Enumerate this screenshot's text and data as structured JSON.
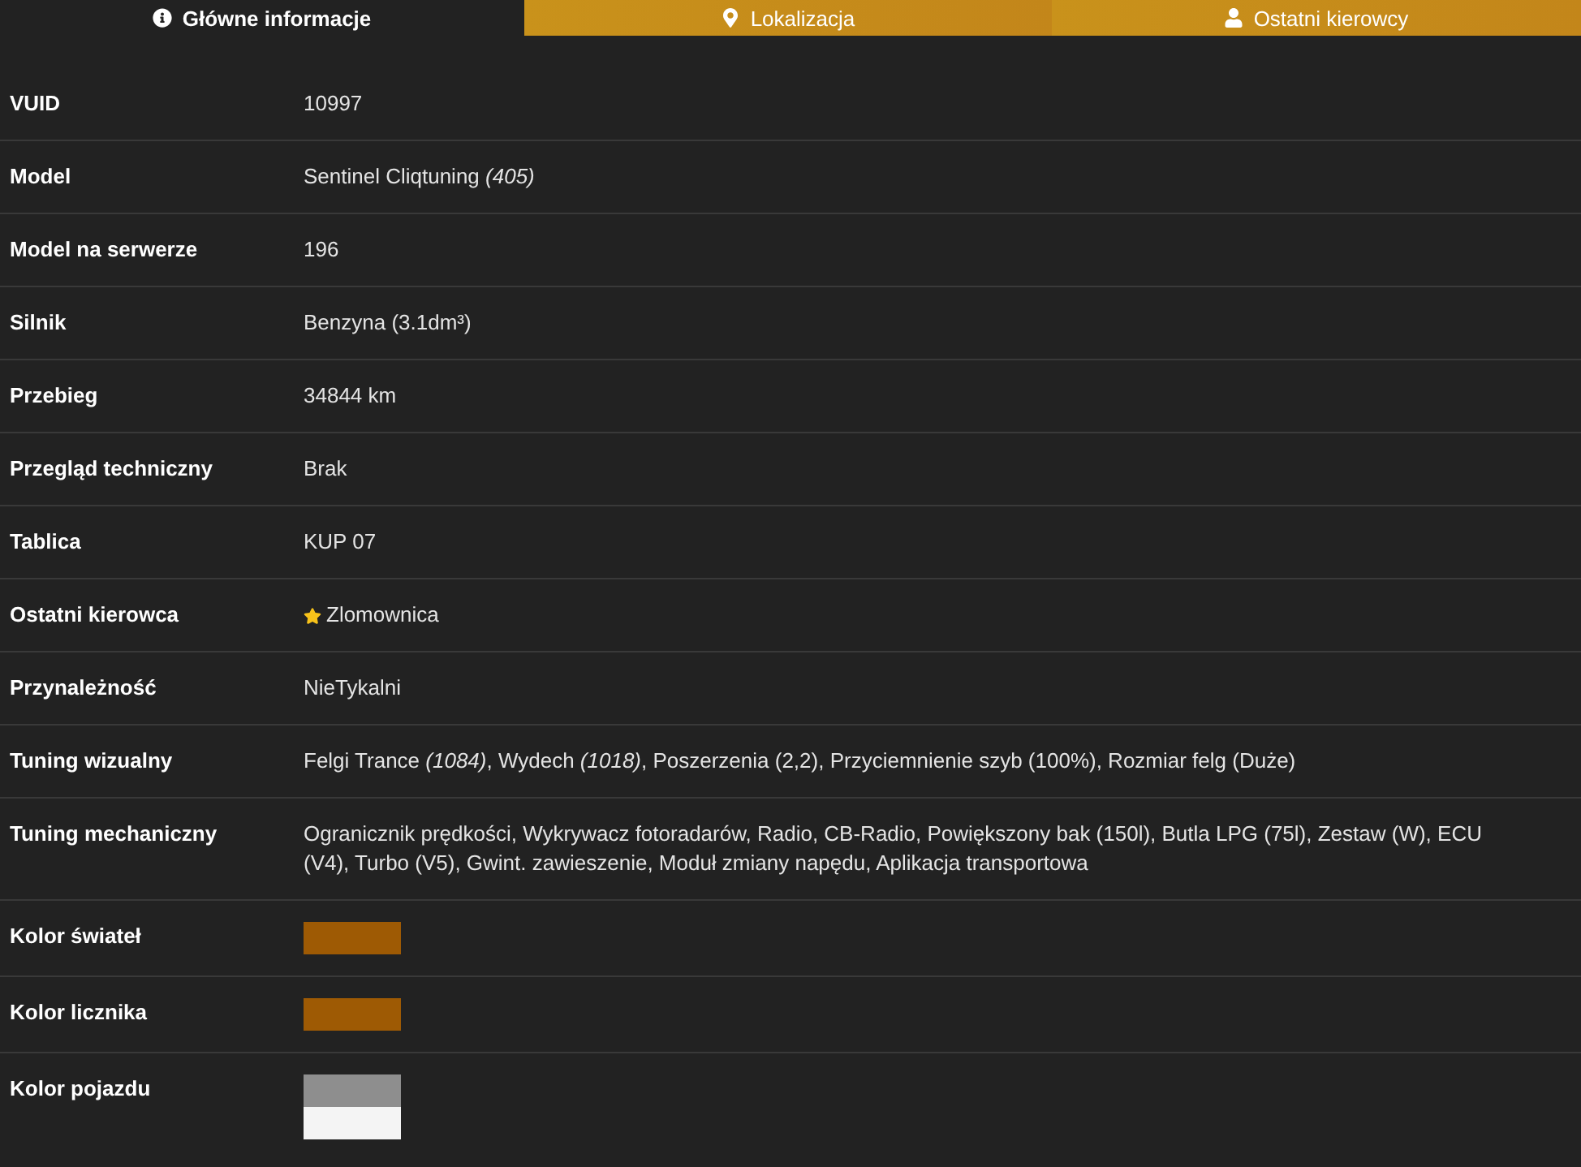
{
  "tabs": [
    {
      "label": "Główne informacje",
      "selected": true
    },
    {
      "label": "Lokalizacja",
      "selected": false
    },
    {
      "label": "Ostatni kierowcy",
      "selected": false
    }
  ],
  "rows": [
    {
      "label": "VUID",
      "kind": "text",
      "value": "10997"
    },
    {
      "label": "Model",
      "kind": "text",
      "value": "Sentinel Cliqtuning *(405)*"
    },
    {
      "label": "Model na serwerze",
      "kind": "text",
      "value": "196"
    },
    {
      "label": "Silnik",
      "kind": "text",
      "value": "Benzyna (3.1dm³)"
    },
    {
      "label": "Przebieg",
      "kind": "text",
      "value": "34844 km"
    },
    {
      "label": "Przegląd techniczny",
      "kind": "text",
      "value": "Brak"
    },
    {
      "label": "Tablica",
      "kind": "text",
      "value": "KUP 07"
    },
    {
      "label": "Ostatni kierowca",
      "kind": "text",
      "value": "Zlomownica",
      "starred": true
    },
    {
      "label": "Przynależność",
      "kind": "text",
      "value": "NieTykalni"
    },
    {
      "label": "Tuning wizualny",
      "kind": "text",
      "value": "Felgi Trance *(1084)*, Wydech *(1018)*, Poszerzenia (2,2), Przyciemnienie szyb (100%), Rozmiar felg (Duże)"
    },
    {
      "label": "Tuning mechaniczny",
      "kind": "text",
      "value": "Ogranicznik prędkości, Wykrywacz fotoradarów, Radio, CB-Radio, Powiększony bak (150l), Butla LPG (75l), Zestaw (W), ECU (V4), Turbo (V5), Gwint. zawieszenie, Moduł zmiany napędu, Aplikacja transportowa"
    },
    {
      "label": "Kolor świateł",
      "kind": "swatches",
      "swatches": [
        {
          "color": "#9e5a04"
        }
      ]
    },
    {
      "label": "Kolor licznika",
      "kind": "swatches",
      "swatches": [
        {
          "color": "#9e5a04"
        }
      ]
    },
    {
      "label": "Kolor pojazdu",
      "kind": "swatches",
      "swatches": [
        {
          "color": "#8e8e8e"
        },
        {
          "color": "#f4f4f4"
        }
      ]
    }
  ]
}
